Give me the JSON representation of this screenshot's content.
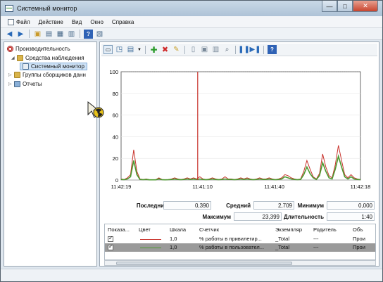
{
  "window": {
    "title": "Системный монитор",
    "controls": {
      "minimize": "—",
      "maximize": "□",
      "close": "✕"
    }
  },
  "menu": [
    "Файл",
    "Действие",
    "Вид",
    "Окно",
    "Справка"
  ],
  "tree": {
    "root": "Производительность",
    "monitoring_tools": "Средства наблюдения",
    "system_monitor": "Системный монитор",
    "collector_sets": "Группы сборщиков данн",
    "reports": "Отчеты"
  },
  "chart_data": {
    "type": "line",
    "ylim": [
      0,
      100
    ],
    "yticks": [
      "100",
      "80",
      "60",
      "40",
      "20",
      "0"
    ],
    "xticks": [
      "11:42:19",
      "11:41:10",
      "11:41:40",
      "11:42:18"
    ],
    "current_time_marker_fraction": 0.32,
    "series": [
      {
        "color": "#c8312a",
        "values": [
          1,
          0.5,
          2,
          5,
          28,
          8,
          1,
          0.5,
          1,
          0.3,
          0.3,
          0.3,
          2,
          0.5,
          0.3,
          0.5,
          1,
          2,
          1,
          0.5,
          1,
          2,
          1,
          2,
          1,
          3,
          1,
          0.5,
          1,
          2,
          1,
          0.5,
          1,
          3,
          1,
          1,
          0.5,
          1,
          2,
          1,
          2,
          1,
          0.5,
          1,
          2,
          1,
          1,
          2,
          1,
          0.5,
          1,
          2,
          5,
          4,
          2,
          1,
          0.5,
          1,
          8,
          18,
          10,
          3,
          1,
          6,
          24,
          12,
          4,
          2,
          14,
          32,
          18,
          5,
          2,
          5,
          2,
          1,
          0.5
        ]
      },
      {
        "color": "#4c9a2f",
        "values": [
          0.5,
          0.3,
          1,
          3,
          18,
          5,
          0.5,
          0.3,
          0.5,
          0.2,
          0.2,
          0.2,
          1,
          0.3,
          0.2,
          0.3,
          0.5,
          1,
          0.5,
          0.3,
          0.5,
          1,
          0.5,
          1,
          0.5,
          1,
          0.5,
          0.3,
          0.5,
          1,
          0.5,
          0.3,
          0.5,
          1,
          0.5,
          0.5,
          0.3,
          0.5,
          1,
          0.5,
          1,
          0.5,
          0.3,
          0.5,
          1,
          0.5,
          0.5,
          1,
          0.5,
          0.3,
          0.5,
          1,
          3,
          2,
          1,
          0.5,
          0.3,
          0.5,
          5,
          12,
          6,
          2,
          0.5,
          4,
          16,
          8,
          2,
          1,
          10,
          22,
          12,
          3,
          1,
          3,
          1,
          0.5,
          0.3
        ]
      }
    ]
  },
  "stats": {
    "last_label": "Последний",
    "last_value": "0,390",
    "avg_label": "Средний",
    "avg_value": "2,709",
    "min_label": "Минимум",
    "min_value": "0,000",
    "max_label": "Максимум",
    "max_value": "23,399",
    "duration_label": "Длительность",
    "duration_value": "1:40"
  },
  "counters": {
    "headers": [
      "Показа...",
      "Цвет",
      "Шкала",
      "Счетчик",
      "Экземпляр",
      "Родитель",
      "Объ"
    ],
    "rows": [
      {
        "scale": "1,0",
        "counter": "% работы в привилегир...",
        "instance": "_Total",
        "parent": "---",
        "object": "Прои",
        "color": "#c8312a"
      },
      {
        "scale": "1,0",
        "counter": "% работы в пользовател...",
        "instance": "_Total",
        "parent": "---",
        "object": "Прои",
        "color": "#4c9a2f"
      }
    ]
  }
}
